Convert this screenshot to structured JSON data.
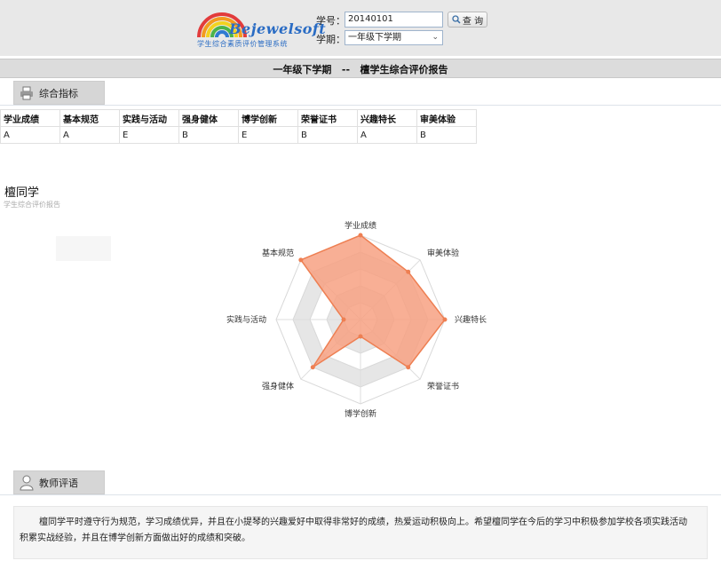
{
  "header": {
    "logo_text": "Bejewelsoft",
    "logo_subtitle": "学生综合素质评价管理系统",
    "student_id_label": "学号：",
    "student_id_value": "20140101",
    "query_button": "查 询",
    "term_label": "学期：",
    "term_selected": "一年级下学期"
  },
  "report": {
    "title": "一年级下学期   --   檀学生综合评价报告"
  },
  "indicators": {
    "tab_label": "综合指标",
    "columns": [
      "学业成绩",
      "基本规范",
      "实践与活动",
      "强身健体",
      "博学创新",
      "荣誉证书",
      "兴趣特长",
      "审美体验"
    ],
    "values": [
      "A",
      "A",
      "E",
      "B",
      "E",
      "B",
      "A",
      "B"
    ]
  },
  "chart_data": {
    "type": "radar",
    "title": "檀同学",
    "subtitle": "学生综合评价报告",
    "axes": [
      "学业成绩",
      "审美体验",
      "兴趣特长",
      "荣誉证书",
      "博学创新",
      "强身健体",
      "实践与活动",
      "基本规范"
    ],
    "grades": [
      "A",
      "B",
      "A",
      "B",
      "E",
      "B",
      "E",
      "A"
    ],
    "values": [
      5,
      4,
      5,
      4,
      1,
      4,
      1,
      5
    ],
    "max": 5,
    "rings": 5,
    "fill_color": "#f7a183",
    "line_color": "#ee7f52",
    "grid_colors": [
      "#ffffff",
      "#e6e6e6"
    ]
  },
  "teacher": {
    "tab_label": "教师评语",
    "comment": "檀同学平时遵守行为规范，学习成绩优异，并且在小提琴的兴趣爱好中取得非常好的成绩，热爱运动积极向上。希望檀同学在今后的学习中积极参加学校各项实践活动积累实战经验，并且在博学创新方面做出好的成绩和突破。"
  }
}
